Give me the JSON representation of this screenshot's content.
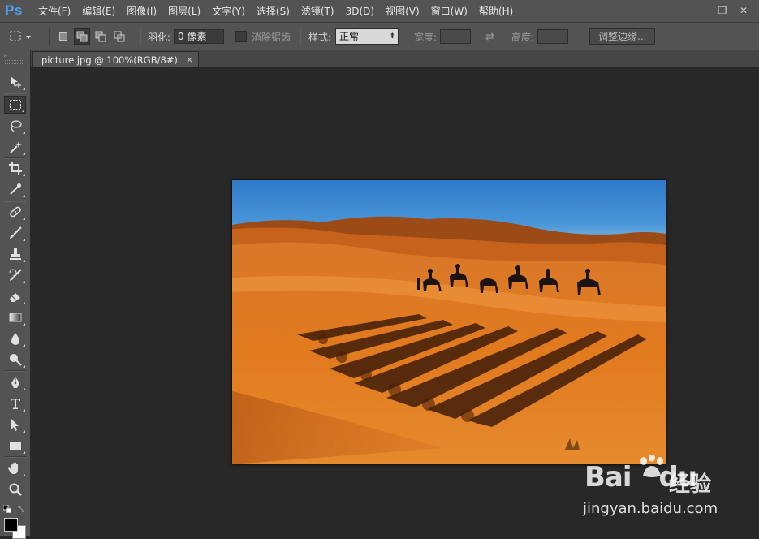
{
  "app": {
    "logo": "Ps"
  },
  "menu": [
    "文件(F)",
    "编辑(E)",
    "图像(I)",
    "图层(L)",
    "文字(Y)",
    "选择(S)",
    "滤镜(T)",
    "3D(D)",
    "视图(V)",
    "窗口(W)",
    "帮助(H)"
  ],
  "window_controls": {
    "minimize": "—",
    "maximize": "❐",
    "close": "✕"
  },
  "options": {
    "feather_label": "羽化:",
    "feather_value": "0 像素",
    "antialias_label": "消除锯齿",
    "style_label": "样式:",
    "style_value": "正常",
    "width_label": "宽度:",
    "width_value": "",
    "swap_icon": "⇄",
    "height_label": "高度:",
    "height_value": "",
    "refine_edge_button": "调整边缘..."
  },
  "document": {
    "tab_title": "picture.jpg @ 100%(RGB/8#)",
    "close_label": "×"
  },
  "tools": [
    {
      "name": "move-tool",
      "icon": "move-icon"
    },
    {
      "name": "rectangular-marquee-tool",
      "icon": "marquee-icon",
      "active": true
    },
    {
      "name": "lasso-tool",
      "icon": "lasso-icon"
    },
    {
      "name": "magic-wand-tool",
      "icon": "magic-wand-icon"
    },
    {
      "name": "crop-tool",
      "icon": "crop-icon"
    },
    {
      "name": "eyedropper-tool",
      "icon": "eyedropper-icon"
    },
    {
      "name": "healing-brush-tool",
      "icon": "bandage-icon"
    },
    {
      "name": "brush-tool",
      "icon": "brush-icon"
    },
    {
      "name": "clone-stamp-tool",
      "icon": "stamp-icon"
    },
    {
      "name": "history-brush-tool",
      "icon": "history-brush-icon"
    },
    {
      "name": "eraser-tool",
      "icon": "eraser-icon"
    },
    {
      "name": "gradient-tool",
      "icon": "gradient-icon"
    },
    {
      "name": "blur-tool",
      "icon": "drop-icon"
    },
    {
      "name": "dodge-tool",
      "icon": "dodge-icon"
    },
    {
      "name": "pen-tool",
      "icon": "pen-icon"
    },
    {
      "name": "type-tool",
      "icon": "type-icon"
    },
    {
      "name": "path-selection-tool",
      "icon": "arrow-icon"
    },
    {
      "name": "rectangle-tool",
      "icon": "rectangle-icon"
    },
    {
      "name": "hand-tool",
      "icon": "hand-icon"
    },
    {
      "name": "zoom-tool",
      "icon": "zoom-icon"
    }
  ],
  "colors": {
    "foreground": "#000000",
    "background": "#ffffff",
    "ui_dark": "#282828",
    "ui_panel": "#535353",
    "logo_blue": "#4ea3f1"
  },
  "watermark": {
    "brand": "Bai",
    "brand_suffix": "du",
    "cn": "经验",
    "url": "jingyan.baidu.com"
  }
}
